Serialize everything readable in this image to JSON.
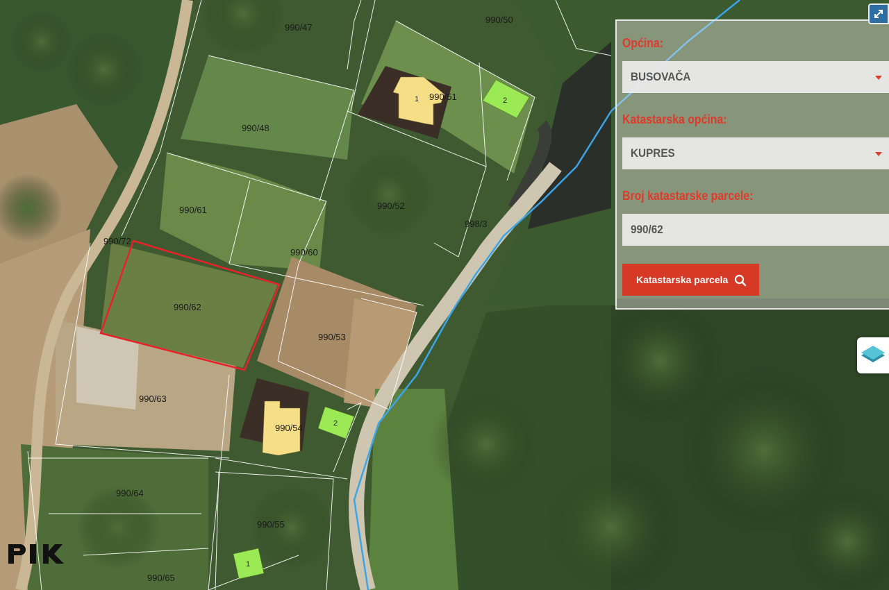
{
  "map": {
    "parcels": [
      {
        "id": "990_47",
        "label": "990/47"
      },
      {
        "id": "990_50",
        "label": "990/50"
      },
      {
        "id": "990_51",
        "label": "990/51"
      },
      {
        "id": "990_48",
        "label": "990/48"
      },
      {
        "id": "990_61",
        "label": "990/61"
      },
      {
        "id": "990_52",
        "label": "990/52"
      },
      {
        "id": "998_3",
        "label": "998/3"
      },
      {
        "id": "990_72",
        "label": "990/72"
      },
      {
        "id": "990_60",
        "label": "990/60"
      },
      {
        "id": "990_62",
        "label": "990/62"
      },
      {
        "id": "990_53",
        "label": "990/53"
      },
      {
        "id": "990_63",
        "label": "990/63"
      },
      {
        "id": "990_54",
        "label": "990/54"
      },
      {
        "id": "990_64",
        "label": "990/64"
      },
      {
        "id": "990_55",
        "label": "990/55"
      },
      {
        "id": "990_65",
        "label": "990/65"
      }
    ],
    "buildings": [
      {
        "id": "b1",
        "number": "1",
        "color": "#f6de86"
      },
      {
        "id": "b2",
        "number": "2",
        "color": "#9bea55"
      },
      {
        "id": "b3",
        "number": "2",
        "color": "#9bea55"
      },
      {
        "id": "b4",
        "number": "1",
        "color": "#9bea55"
      },
      {
        "id": "b5",
        "number": "",
        "color": "#f6de86"
      }
    ],
    "highlight_color": "#e8212a",
    "stream_color": "#3aa5ea",
    "boundary_color": "#ffffff"
  },
  "panel": {
    "municipality_label": "Općina:",
    "municipality_value": "BUSOVAČA",
    "cadastral_municipality_label": "Katastarska općina:",
    "cadastral_municipality_value": "KUPRES",
    "parcel_number_label": "Broj katastarske parcele:",
    "parcel_number_value": "990/62",
    "search_button_label": "Katastarska parcela",
    "accent_color": "#e03a2a",
    "button_color": "#d63a26"
  },
  "controls": {
    "fullscreen_icon": "expand-arrows-icon",
    "layers_icon": "layers-icon",
    "logo_text": "PIK"
  }
}
